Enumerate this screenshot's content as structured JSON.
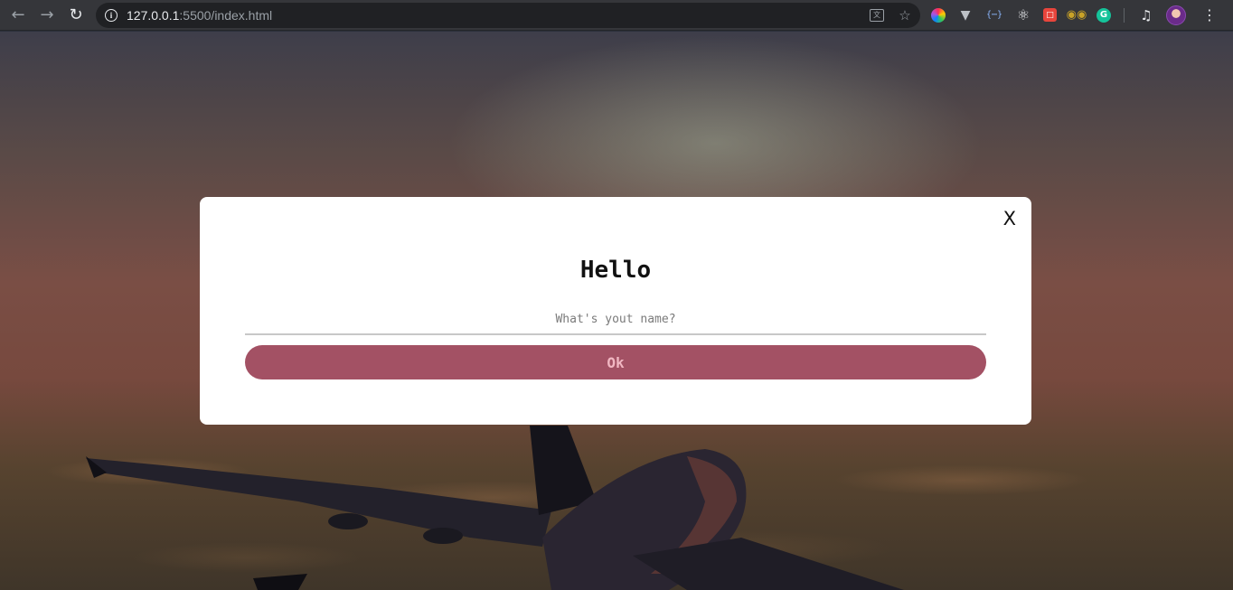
{
  "browser": {
    "url_host": "127.0.0.1",
    "url_rest": ":5500/index.html",
    "icons": {
      "back": "arrow-left-icon",
      "forward": "arrow-right-icon",
      "reload": "reload-icon",
      "info": "info-icon",
      "translate": "translate-icon",
      "bookmark": "star-icon",
      "menu": "kebab-menu-icon"
    },
    "extensions": [
      "color-wheel-icon",
      "vue-devtools-icon",
      "json-viewer-icon",
      "react-devtools-icon",
      "extension-box-icon",
      "glasses-icon",
      "grammarly-icon"
    ],
    "grammarly_letter": "G"
  },
  "modal": {
    "close_label": "X",
    "title": "Hello",
    "input_placeholder": "What's yout name?",
    "input_value": "",
    "submit_label": "Ok"
  },
  "colors": {
    "button_bg": "#a35164",
    "button_text": "#f1b7c2",
    "modal_bg": "#ffffff",
    "toolbar_bg": "#35363a"
  }
}
